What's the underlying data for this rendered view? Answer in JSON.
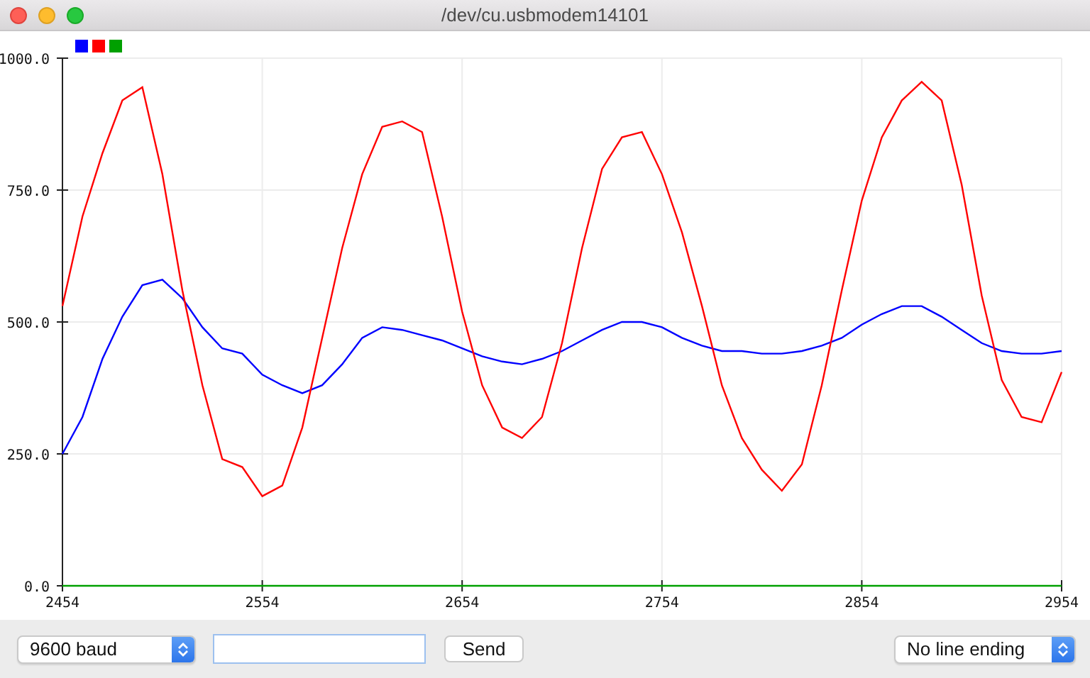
{
  "window": {
    "title": "/dev/cu.usbmodem14101"
  },
  "plot": {
    "chart_data": {
      "type": "line",
      "x": [
        2454,
        2464,
        2474,
        2484,
        2494,
        2504,
        2514,
        2524,
        2534,
        2544,
        2554,
        2564,
        2574,
        2584,
        2594,
        2604,
        2614,
        2624,
        2634,
        2644,
        2654,
        2664,
        2674,
        2684,
        2694,
        2704,
        2714,
        2724,
        2734,
        2744,
        2754,
        2764,
        2774,
        2784,
        2794,
        2804,
        2814,
        2824,
        2834,
        2844,
        2854,
        2864,
        2874,
        2884,
        2894,
        2904,
        2914,
        2924,
        2934,
        2944,
        2954
      ],
      "grid": true,
      "xlim": [
        2454,
        2954
      ],
      "ylim": [
        0,
        1000
      ],
      "xticks": [
        2454,
        2554,
        2654,
        2754,
        2854,
        2954
      ],
      "yticks": [
        {
          "value": 0,
          "label": "0.0"
        },
        {
          "value": 250,
          "label": "250.0"
        },
        {
          "value": 500,
          "label": "500.0"
        },
        {
          "value": 750,
          "label": "750.0"
        },
        {
          "value": 1000,
          "label": "1000.0"
        }
      ],
      "series": [
        {
          "color": "#0000ff",
          "values": [
            250,
            320,
            430,
            510,
            570,
            580,
            545,
            490,
            450,
            440,
            400,
            380,
            365,
            380,
            420,
            470,
            490,
            485,
            475,
            465,
            450,
            435,
            425,
            420,
            430,
            445,
            465,
            485,
            500,
            500,
            490,
            470,
            455,
            445,
            445,
            440,
            440,
            445,
            455,
            470,
            495,
            515,
            530,
            530,
            510,
            485,
            460,
            445,
            440,
            440,
            445
          ]
        },
        {
          "color": "#ff0000",
          "values": [
            530,
            700,
            820,
            920,
            945,
            780,
            560,
            380,
            240,
            225,
            170,
            190,
            300,
            470,
            640,
            780,
            870,
            880,
            860,
            700,
            520,
            380,
            300,
            280,
            320,
            460,
            640,
            790,
            850,
            860,
            780,
            670,
            530,
            380,
            280,
            220,
            180,
            230,
            380,
            560,
            730,
            850,
            920,
            955,
            920,
            760,
            550,
            390,
            320,
            310,
            405
          ]
        },
        {
          "color": "#00a000",
          "values": [
            0,
            0,
            0,
            0,
            0,
            0,
            0,
            0,
            0,
            0,
            0,
            0,
            0,
            0,
            0,
            0,
            0,
            0,
            0,
            0,
            0,
            0,
            0,
            0,
            0,
            0,
            0,
            0,
            0,
            0,
            0,
            0,
            0,
            0,
            0,
            0,
            0,
            0,
            0,
            0,
            0,
            0,
            0,
            0,
            0,
            0,
            0,
            0,
            0,
            0,
            0
          ]
        }
      ]
    }
  },
  "toolbar": {
    "baud": "9600 baud",
    "send_button": "Send",
    "line_ending": "No line ending"
  }
}
